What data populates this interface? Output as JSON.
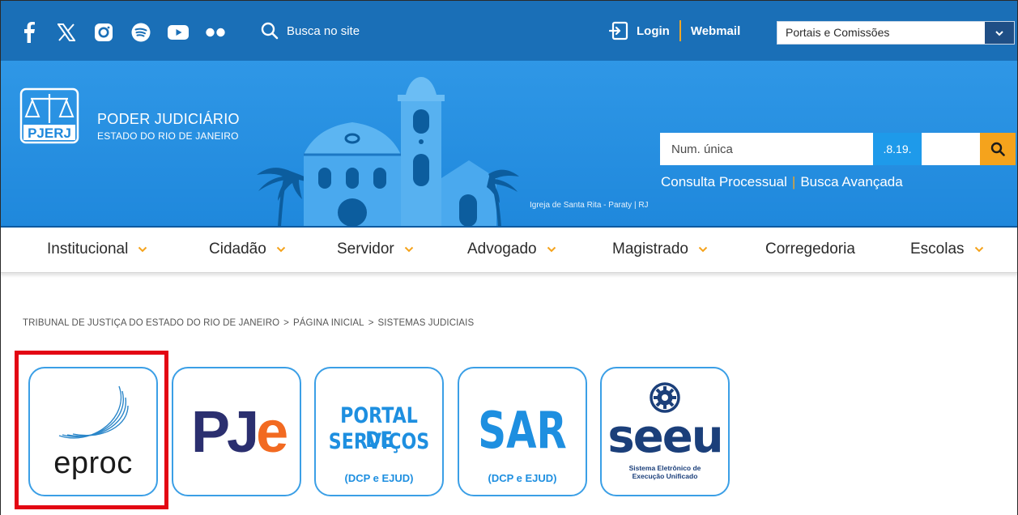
{
  "topbar": {
    "social_icons": [
      "facebook-icon",
      "x-icon",
      "instagram-icon",
      "spotify-icon",
      "youtube-icon",
      "flickr-icon"
    ],
    "search_label": "Busca no site",
    "login_label": "Login",
    "webmail_label": "Webmail",
    "portais_select": "Portais e Comissões"
  },
  "banner": {
    "logo_abbrev": "PJERJ",
    "org_line1": "PODER JUDICIÁRIO",
    "org_line2": "ESTADO DO RIO DE JANEIRO",
    "photo_caption": "Igreja de Santa Rita - Paraty | RJ",
    "consulta_label": "Consulta Processual",
    "busca_avancada_label": "Busca Avançada",
    "num_placeholder": "Num. única",
    "tj_code": ".8.19."
  },
  "nav": {
    "items": [
      {
        "label": "Institucional",
        "has_dropdown": true
      },
      {
        "label": "Cidadão",
        "has_dropdown": true
      },
      {
        "label": "Servidor",
        "has_dropdown": true
      },
      {
        "label": "Advogado",
        "has_dropdown": true
      },
      {
        "label": "Magistrado",
        "has_dropdown": true
      },
      {
        "label": "Corregedoria",
        "has_dropdown": false
      },
      {
        "label": "Escolas",
        "has_dropdown": true
      }
    ]
  },
  "breadcrumb": {
    "items": [
      "TRIBUNAL DE JUSTIÇA DO ESTADO DO RIO DE JANEIRO",
      "PÁGINA INICIAL",
      "SISTEMAS JUDICIAIS"
    ],
    "separator": ">"
  },
  "tiles": {
    "eproc": {
      "label": "eproc"
    },
    "pje": {
      "label_pj": "PJ",
      "label_e": "e"
    },
    "portal": {
      "line1": "PORTAL DE",
      "line2": "SERVIÇOS",
      "sub": "(DCP e EJUD)"
    },
    "sar": {
      "line1": "SAR",
      "sub": "(DCP e EJUD)"
    },
    "seeu": {
      "label": "seeu",
      "sub1": "Sistema Eletrônico de",
      "sub2": "Execução Unificado"
    }
  },
  "colors": {
    "topbar": "#1a6fb7",
    "banner": "#2a93e4",
    "accent_orange": "#f5a31c",
    "tile_border": "#3b9fe6",
    "highlight_red": "#e30613"
  }
}
